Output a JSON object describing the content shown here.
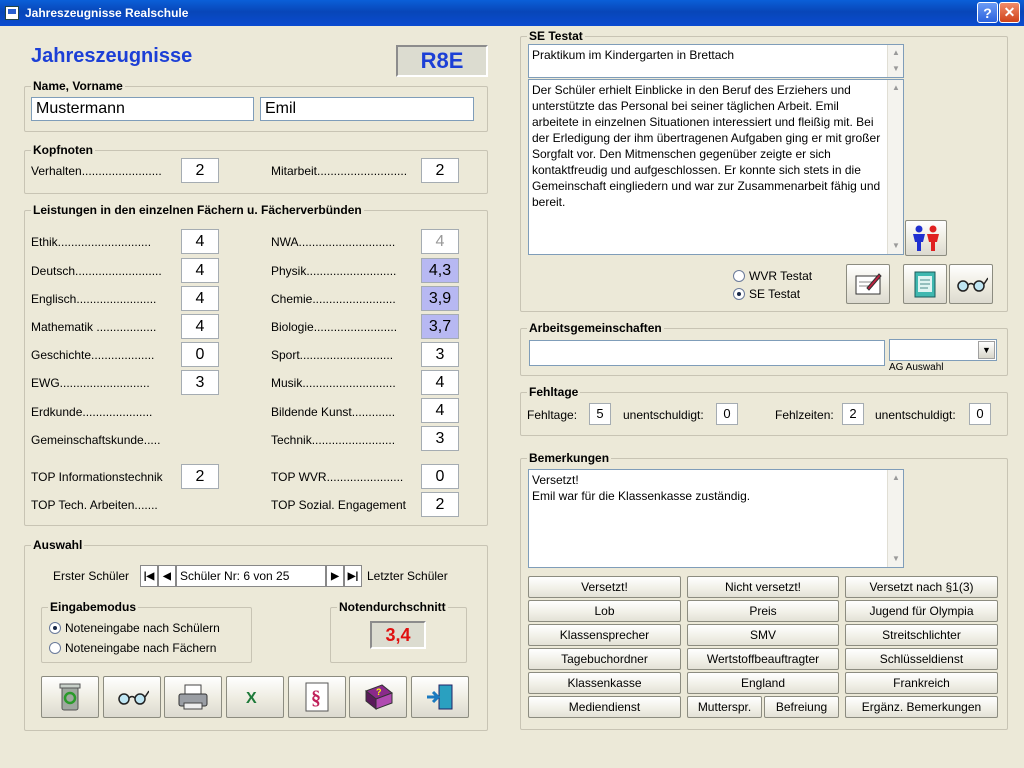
{
  "window": {
    "title": "Jahreszeugnisse Realschule",
    "help": "?",
    "close": "✕"
  },
  "header": {
    "title": "Jahreszeugnisse",
    "class": "R8E"
  },
  "name": {
    "label": "Name, Vorname",
    "last": "Mustermann",
    "first": "Emil"
  },
  "kopfnoten": {
    "label": "Kopfnoten",
    "verhalten_label": "Verhalten........................",
    "verhalten": "2",
    "mitarbeit_label": "Mitarbeit...........................",
    "mitarbeit": "2"
  },
  "leistungen": {
    "label": "Leistungen in den einzelnen Fächern u. Fächerverbünden",
    "left": [
      {
        "label": "Ethik............................",
        "grade": "4"
      },
      {
        "label": "Deutsch..........................",
        "grade": "4"
      },
      {
        "label": "Englisch........................",
        "grade": "4"
      },
      {
        "label": "Mathematik ..................",
        "grade": "4"
      },
      {
        "label": "Geschichte...................",
        "grade": "0"
      },
      {
        "label": "EWG...........................",
        "grade": "3"
      },
      {
        "label": "Erdkunde.....................",
        "grade": ""
      },
      {
        "label": "Gemeinschaftskunde.....",
        "grade": ""
      }
    ],
    "right": [
      {
        "label": "NWA.............................",
        "grade": "4"
      },
      {
        "label": "Physik...........................",
        "grade": "4,3"
      },
      {
        "label": "Chemie.........................",
        "grade": "3,9"
      },
      {
        "label": "Biologie.........................",
        "grade": "3,7"
      },
      {
        "label": "Sport............................",
        "grade": "3"
      },
      {
        "label": "Musik............................",
        "grade": "4"
      },
      {
        "label": "Bildende Kunst.............",
        "grade": "4"
      },
      {
        "label": "Technik.........................",
        "grade": "3"
      }
    ],
    "top": [
      {
        "label": "TOP Informationstechnik",
        "grade": "2"
      },
      {
        "label": "TOP Tech. Arbeiten.......",
        "grade": ""
      },
      {
        "label": "TOP WVR.......................",
        "grade": "0"
      },
      {
        "label": "TOP Sozial. Engagement",
        "grade": "2"
      }
    ]
  },
  "auswahl": {
    "label": "Auswahl",
    "first_label": "Erster Schüler",
    "nav_text": "Schüler Nr: 6 von 25",
    "last_label": "Letzter Schüler",
    "mode_label": "Eingabemodus",
    "mode_options": [
      "Noteneingabe nach Schülern",
      "Noteneingabe nach Fächern"
    ],
    "avg_label": "Notendurchschnitt",
    "avg": "3,4"
  },
  "se_testat": {
    "label": "SE Testat",
    "title": "Praktikum im Kindergarten in Brettach",
    "text": "Der Schüler erhielt Einblicke in den Beruf des Erziehers und unterstützte das Personal bei seiner täglichen Arbeit. Emil arbeitete in einzelnen Situationen interessiert und fleißig mit. Bei der Erledigung der ihm übertragenen Aufgaben ging er mit großer Sorgfalt vor. Den Mitmenschen gegenüber zeigte er sich kontaktfreudig und aufgeschlossen. Er konnte sich stets in die Gemeinschaft eingliedern und war zur Zusammenarbeit fähig und bereit.",
    "radio_wvr": "WVR Testat",
    "radio_se": "SE Testat"
  },
  "ag": {
    "label": "Arbeitsgemeinschaften",
    "value": "",
    "select_value": "",
    "select_caption": "AG Auswahl"
  },
  "fehltage": {
    "label": "Fehltage",
    "fehltage_label": "Fehltage:",
    "fehltage": "5",
    "unent1_label": "unentschuldigt:",
    "unent1": "0",
    "fehlzeiten_label": "Fehlzeiten:",
    "fehlzeiten": "2",
    "unent2_label": "unentschuldigt:",
    "unent2": "0"
  },
  "bemerkungen": {
    "label": "Bemerkungen",
    "line1": "Versetzt!",
    "line2": "Emil war für die Klassenkasse zuständig.",
    "buttons": [
      "Versetzt!",
      "Nicht versetzt!",
      "Versetzt nach §1(3)",
      "Lob",
      "Preis",
      "Jugend für Olympia",
      "Klassensprecher",
      "SMV",
      "Streitschlichter",
      "Tagebuchordner",
      "Wertstoffbeauftragter",
      "Schlüsseldienst",
      "Klassenkasse",
      "England",
      "Frankreich"
    ],
    "last_row": [
      "Mediendienst",
      "Mutterspr.",
      "Befreiung",
      "Ergänz. Bemerkungen"
    ]
  },
  "icons": [
    "recycle-bin-icon",
    "glasses-icon",
    "printer-icon",
    "excel-icon",
    "paragraph-icon",
    "help-book-icon",
    "exit-door-icon",
    "persons-icon",
    "edit-certificate-icon",
    "notepad-icon"
  ]
}
